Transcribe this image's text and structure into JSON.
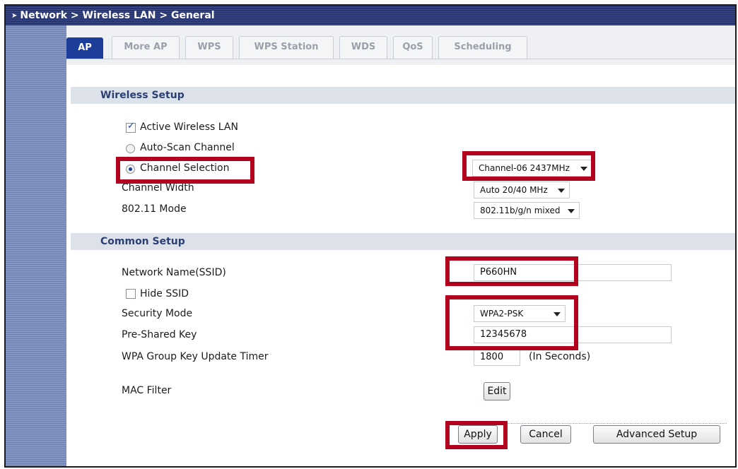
{
  "breadcrumb": "Network > Wireless LAN > General",
  "tabs": [
    "AP",
    "More AP",
    "WPS",
    "WPS Station",
    "WDS",
    "QoS",
    "Scheduling"
  ],
  "wireless_setup": {
    "title": "Wireless Setup",
    "active_wireless_lan": "Active Wireless LAN",
    "auto_scan_channel": "Auto-Scan Channel",
    "channel_selection": "Channel Selection",
    "channel_value": "Channel-06 2437MHz",
    "channel_width_label": "Channel Width",
    "channel_width_value": "Auto 20/40 MHz",
    "mode_label": "802.11 Mode",
    "mode_value": "802.11b/g/n mixed"
  },
  "common_setup": {
    "title": "Common Setup",
    "ssid_label": "Network Name(SSID)",
    "ssid_value": "P660HN",
    "hide_ssid": "Hide SSID",
    "security_label": "Security Mode",
    "security_value": "WPA2-PSK",
    "psk_label": "Pre-Shared Key",
    "psk_value": "12345678",
    "timer_label": "WPA Group Key Update Timer",
    "timer_value": "1800",
    "timer_unit": "(In Seconds)",
    "mac_label": "MAC Filter",
    "edit_label": "Edit"
  },
  "buttons": {
    "apply": "Apply",
    "cancel": "Cancel",
    "advanced": "Advanced Setup"
  },
  "colors": {
    "highlight": "#b3001e",
    "accent": "#1d3d9a"
  }
}
